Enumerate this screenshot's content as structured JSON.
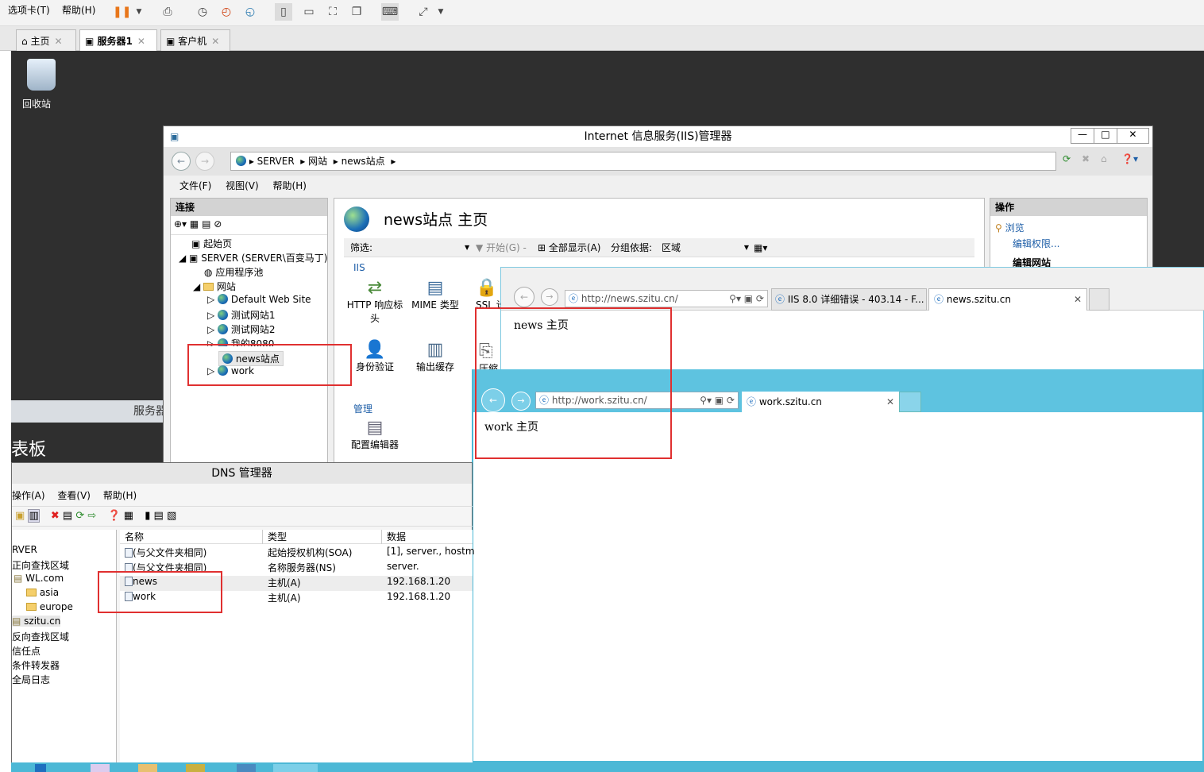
{
  "vm": {
    "menu_tab": "选项卡(T)",
    "menu_help": "帮助(H)"
  },
  "tabs": [
    {
      "label": "主页"
    },
    {
      "label": "服务器1"
    },
    {
      "label": "客户机"
    }
  ],
  "desktop": {
    "recycle": "回收站",
    "server_label": "服务器",
    "panel_label": "表板"
  },
  "iis": {
    "title": "Internet 信息服务(IIS)管理器",
    "crumbs": [
      "SERVER",
      "网站",
      "news站点"
    ],
    "menu": [
      "文件(F)",
      "视图(V)",
      "帮助(H)"
    ],
    "conn_title": "连接",
    "tree": [
      "起始页",
      "SERVER (SERVER\\百变马丁)",
      "应用程序池",
      "网站",
      "Default Web Site",
      "测试网站1",
      "测试网站2",
      "我的8080",
      "news站点",
      "work"
    ],
    "home_title": "news站点 主页",
    "filter_label": "筛选:",
    "filter_start": "开始(G)",
    "filter_showall": "全部显示(A)",
    "group_label": "分组依据:",
    "group_value": "区域",
    "section_iis": "IIS",
    "section_manage": "管理",
    "features": [
      "HTTP 响应标头",
      "MIME 类型",
      "SSL 设",
      "身份验证",
      "输出缓存",
      "压缩",
      "配置编辑器"
    ],
    "actions_title": "操作",
    "act_browse": "浏览",
    "act_edit_perm": "编辑权限...",
    "act_edit_site": "编辑网站"
  },
  "ie1": {
    "url": "http://news.szitu.cn/",
    "tab1": "IIS 8.0 详细错误 - 403.14 - F...",
    "tab2": "news.szitu.cn",
    "content": "news 主页"
  },
  "ie2": {
    "url": "http://work.szitu.cn/",
    "tab1": "work.szitu.cn",
    "content": "work 主页"
  },
  "dns": {
    "title": "DNS 管理器",
    "menu": [
      "操作(A)",
      "查看(V)",
      "帮助(H)"
    ],
    "tree": [
      "RVER",
      "正向查找区域",
      "WL.com",
      "asia",
      "europe",
      "szitu.cn",
      "反向查找区域",
      "信任点",
      "条件转发器",
      "全局日志"
    ],
    "cols": [
      "名称",
      "类型",
      "数据"
    ],
    "rows": [
      [
        "(与父文件夹相同)",
        "起始授权机构(SOA)",
        "[1], server., hostm"
      ],
      [
        "(与父文件夹相同)",
        "名称服务器(NS)",
        "server."
      ],
      [
        "news",
        "主机(A)",
        "192.168.1.20"
      ],
      [
        "work",
        "主机(A)",
        "192.168.1.20"
      ]
    ]
  }
}
